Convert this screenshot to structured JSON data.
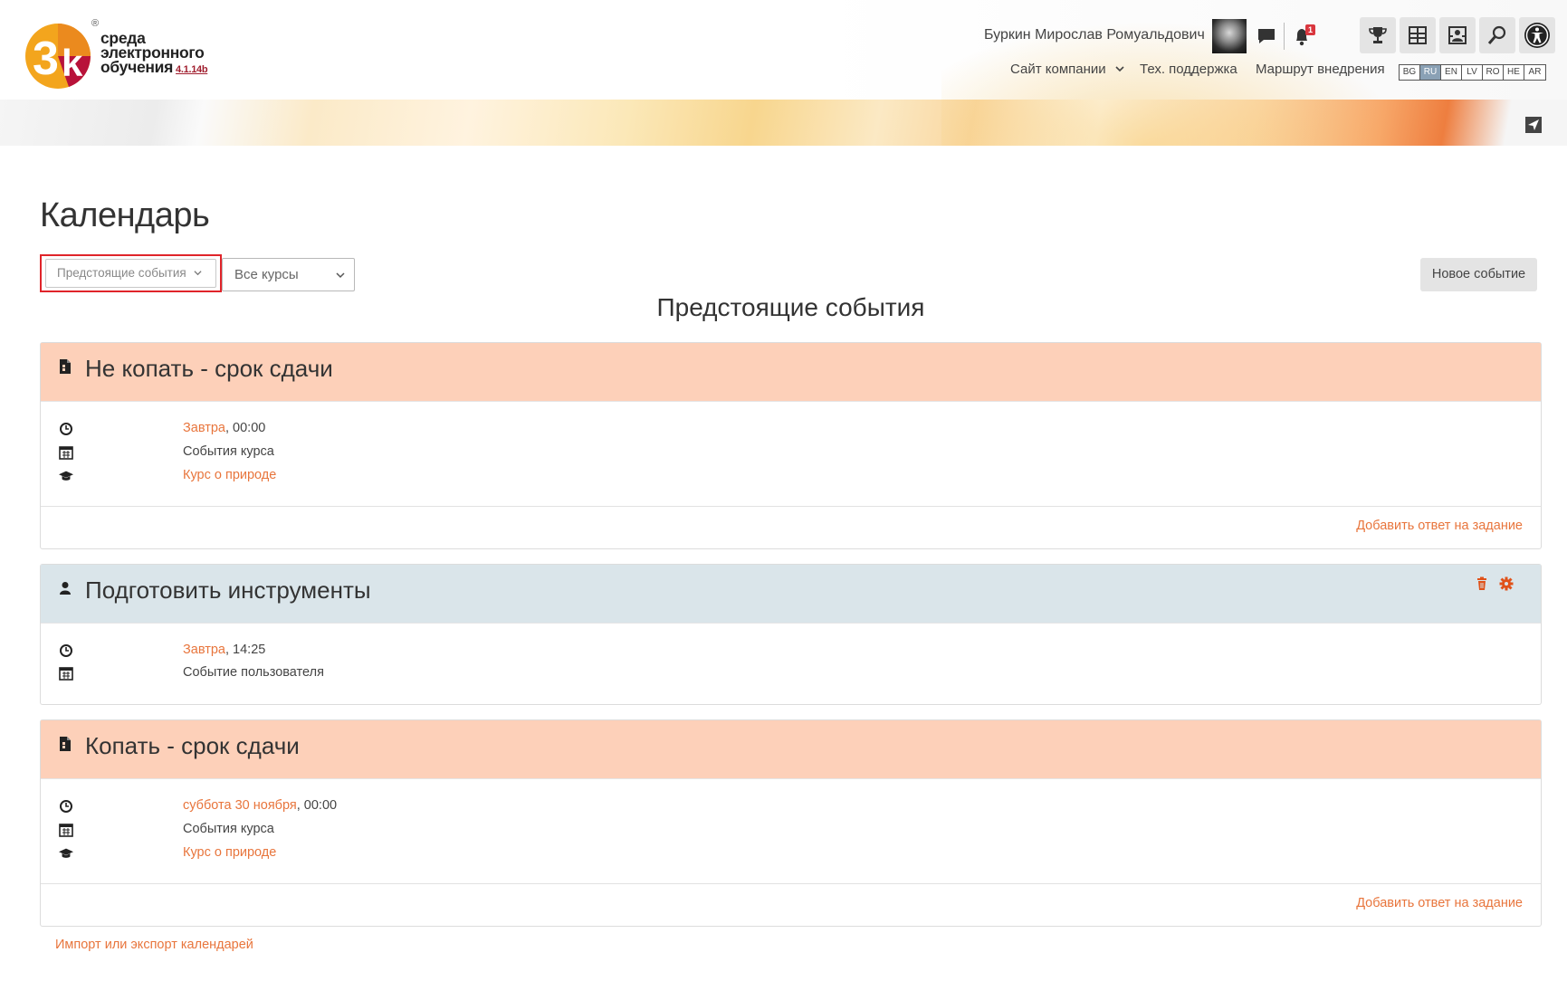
{
  "brand": {
    "logo_big": "3k",
    "logo_reg": "®",
    "line1": "среда",
    "line2": "электронного",
    "line3": "обучения",
    "version": "4.1.14b"
  },
  "user": {
    "name": "Буркин Мирослав Ромуальдович",
    "notifications_count": "1"
  },
  "nav": {
    "company_site": "Сайт компании",
    "support": "Тех. поддержка",
    "roadmap": "Маршрут внедрения"
  },
  "languages": [
    {
      "code": "BG",
      "active": false
    },
    {
      "code": "RU",
      "active": true
    },
    {
      "code": "EN",
      "active": false
    },
    {
      "code": "LV",
      "active": false
    },
    {
      "code": "RO",
      "active": false
    },
    {
      "code": "HE",
      "active": false
    },
    {
      "code": "AR",
      "active": false
    }
  ],
  "page": {
    "title": "Календарь",
    "view_select": "Предстоящие события",
    "course_select": "Все курсы",
    "new_event": "Новое событие",
    "section_title": "Предстоящие события",
    "import_export": "Импорт или экспорт календарей"
  },
  "events": [
    {
      "title": "Не копать - срок сдачи",
      "kind": "course",
      "date_link": "Завтра",
      "time": ", 00:00",
      "type": "События курса",
      "course": "Курс о природе",
      "footer_link": "Добавить ответ на задание"
    },
    {
      "title": "Подготовить инструменты",
      "kind": "user",
      "date_link": "Завтра",
      "time": ", 14:25",
      "type": "Событие пользователя"
    },
    {
      "title": "Копать - срок сдачи",
      "kind": "course",
      "date_link": "суббота 30 ноября",
      "time": ", 00:00",
      "type": "События курса",
      "course": "Курс о природе",
      "footer_link": "Добавить ответ на задание"
    }
  ],
  "colors": {
    "accent": "#e8753c",
    "course_event_bg": "#fdd0b9",
    "user_event_bg": "#dae5ea",
    "highlight_border": "#e0242a"
  }
}
